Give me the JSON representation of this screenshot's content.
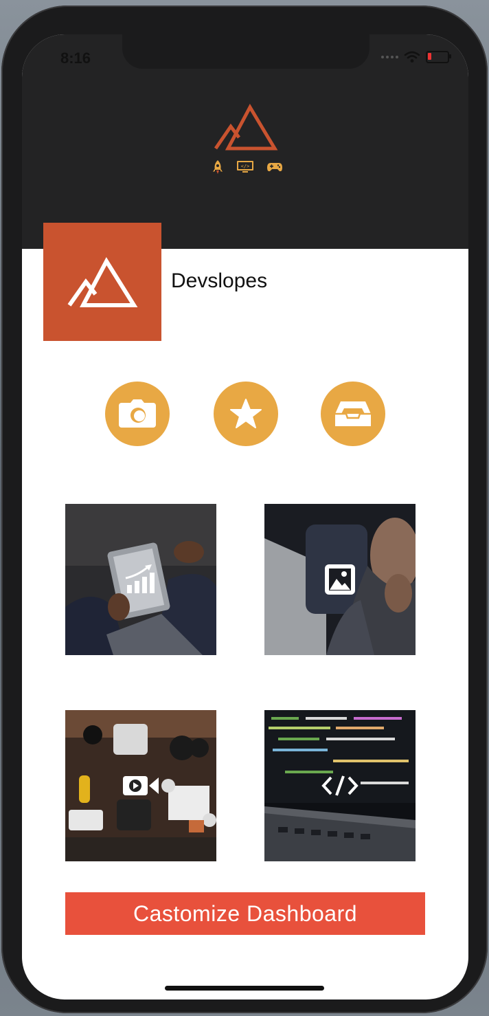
{
  "status_bar": {
    "time": "8:16"
  },
  "header": {
    "logo_icon": "mountain-logo-icon",
    "mini_icons": [
      "rocket-icon",
      "code-monitor-icon",
      "gamepad-icon"
    ]
  },
  "profile": {
    "name": "Devslopes",
    "logo_icon": "mountain-logo-icon"
  },
  "actions": [
    {
      "icon": "camera-icon"
    },
    {
      "icon": "star-icon"
    },
    {
      "icon": "inbox-icon"
    }
  ],
  "tiles": [
    {
      "icon": "chart-icon",
      "subject": "tablet-analytics-photo"
    },
    {
      "icon": "image-icon",
      "subject": "person-thinking-photo"
    },
    {
      "icon": "video-icon",
      "subject": "camera-gear-photo"
    },
    {
      "icon": "code-icon",
      "subject": "laptop-code-photo"
    }
  ],
  "cta": {
    "label": "Castomize Dashboard"
  },
  "colors": {
    "header_bg": "#232324",
    "brand_orange": "#c9532f",
    "accent_yellow": "#e8a844",
    "cta_red": "#e8513c"
  }
}
